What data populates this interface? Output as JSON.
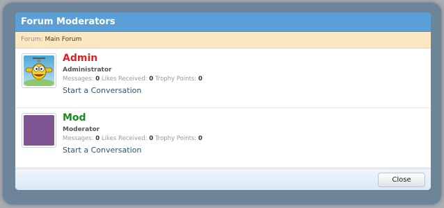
{
  "dialog": {
    "title": "Forum Moderators",
    "forum_label": "Forum:",
    "forum_name": "Main Forum",
    "close_label": "Close"
  },
  "stats_labels": {
    "messages": "Messages:",
    "likes": "Likes Received:",
    "trophy": "Trophy Points:"
  },
  "members": [
    {
      "name": "Admin",
      "name_color": "#e31f1f",
      "title": "Administrator",
      "messages": "0",
      "likes": "0",
      "trophy": "0",
      "action": "Start a Conversation",
      "avatar_icon": "cartoon-airplane-icon"
    },
    {
      "name": "Mod",
      "name_color": "#1b8a1b",
      "title": "Moderator",
      "messages": "0",
      "likes": "0",
      "trophy": "0",
      "action": "Start a Conversation",
      "avatar_icon": "purple-square-avatar",
      "avatar_color": "#7e5592"
    }
  ]
}
